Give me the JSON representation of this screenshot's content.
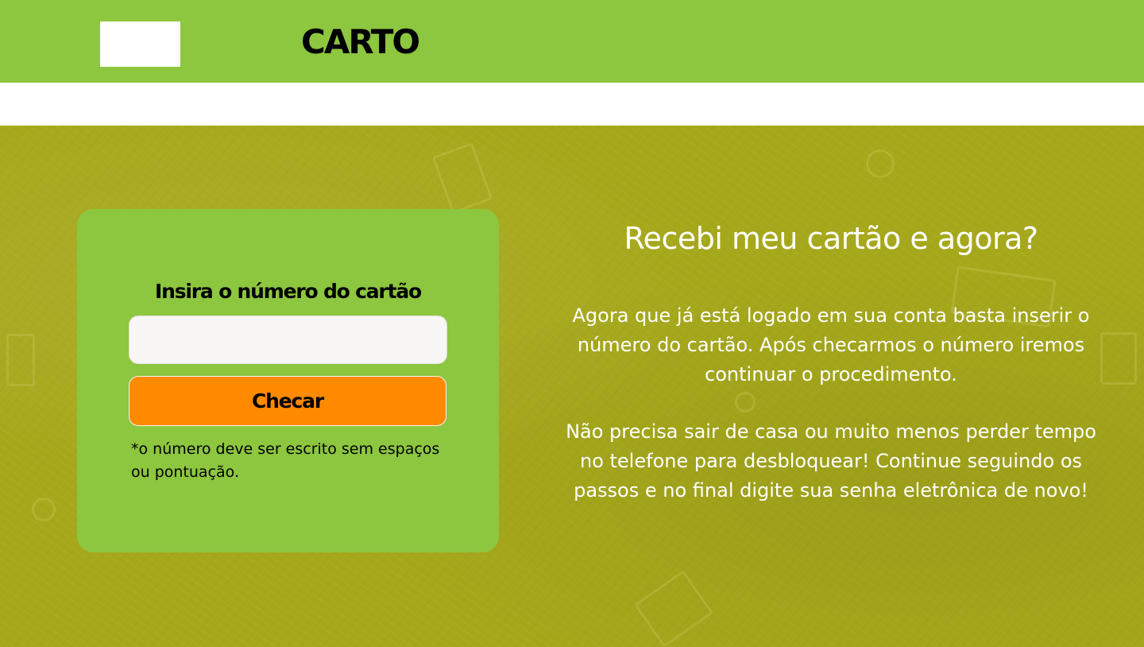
{
  "header": {
    "brand": "CARTO",
    "background": "#8dc63f"
  },
  "card": {
    "title": "Insira o número do cartão",
    "input_value": "",
    "input_placeholder": "",
    "button_label": "Checar",
    "note": "*o número deve ser escrito sem espaços ou pontuação.",
    "button_color": "#ff8a00"
  },
  "info": {
    "heading": "Recebi meu  cartão e agora?",
    "paragraph1": "Agora que já está logado em sua conta basta inserir o número do cartão. Após checarmos o número iremos continuar o procedimento.",
    "paragraph2": "Não precisa sair de casa ou muito menos perder tempo no telefone para desbloquear! Continue seguindo os passos e no final digite sua senha eletrônica de novo!"
  },
  "hero": {
    "background": "#a6a81b"
  }
}
